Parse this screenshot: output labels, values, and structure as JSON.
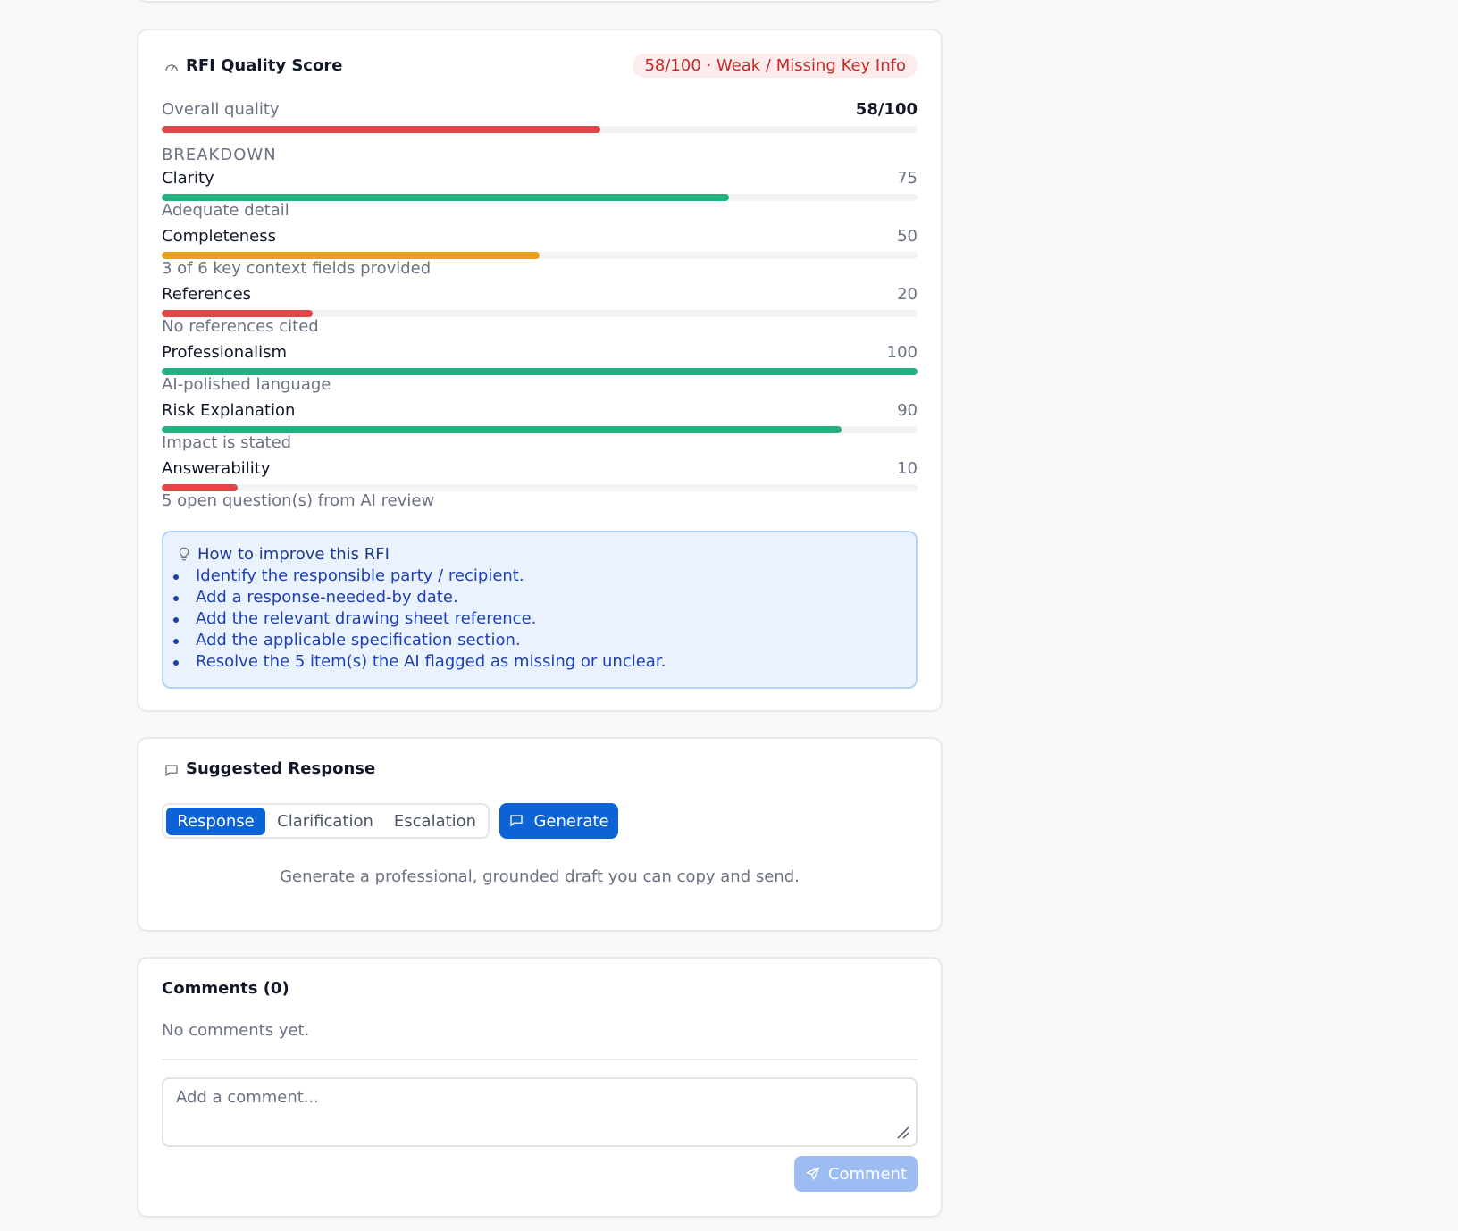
{
  "quality": {
    "title": "RFI Quality Score",
    "badge": "58/100 · Weak / Missing Key Info",
    "overall_label": "Overall quality",
    "overall_value": "58/100",
    "overall_score": 58,
    "breakdown_heading": "BREAKDOWN",
    "items": [
      {
        "label": "Clarity",
        "value": "75",
        "score": 75,
        "note": "Adequate detail",
        "color": "#22b07d"
      },
      {
        "label": "Completeness",
        "value": "50",
        "score": 50,
        "note": "3 of 6 key context fields provided",
        "color": "#e8a21a"
      },
      {
        "label": "References",
        "value": "20",
        "score": 20,
        "note": "No references cited",
        "color": "#e04646"
      },
      {
        "label": "Professionalism",
        "value": "100",
        "score": 100,
        "note": "AI-polished language",
        "color": "#22b07d"
      },
      {
        "label": "Risk Explanation",
        "value": "90",
        "score": 90,
        "note": "Impact is stated",
        "color": "#22b07d"
      },
      {
        "label": "Answerability",
        "value": "10",
        "score": 10,
        "note": "5 open question(s) from AI review",
        "color": "#e04646"
      }
    ],
    "overall_color": "#e04646",
    "tips": {
      "title": "How to improve this RFI",
      "items": [
        "Identify the responsible party / recipient.",
        "Add a response-needed-by date.",
        "Add the relevant drawing sheet reference.",
        "Add the applicable specification section.",
        "Resolve the 5 item(s) the AI flagged as missing or unclear."
      ]
    }
  },
  "suggested": {
    "title": "Suggested Response",
    "tabs": [
      "Response",
      "Clarification",
      "Escalation"
    ],
    "active_tab": "Response",
    "generate_label": "Generate",
    "hint": "Generate a professional, grounded draft you can copy and send."
  },
  "comments": {
    "title": "Comments (0)",
    "empty": "No comments yet.",
    "placeholder": "Add a comment...",
    "submit_label": "Comment"
  },
  "colors": {
    "accent": "#0b63d6",
    "good": "#22b07d",
    "warn": "#e8a21a",
    "bad": "#e04646"
  }
}
